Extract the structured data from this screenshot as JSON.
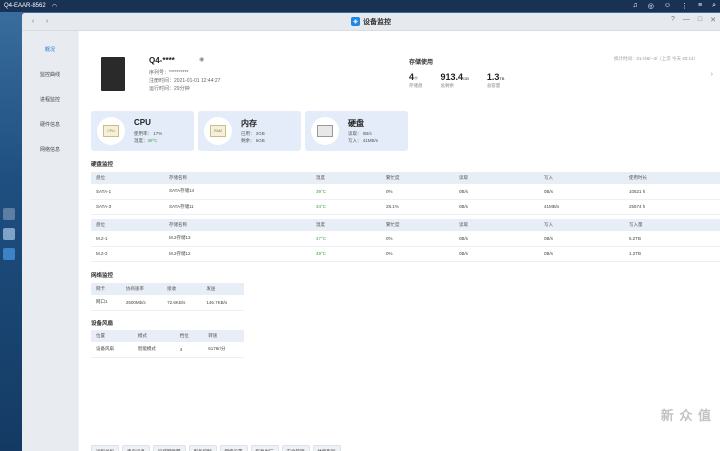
{
  "os": {
    "host": "Q4-EAAR-8562",
    "wifi_icon": "wifi-icon"
  },
  "window": {
    "title": "设备监控"
  },
  "sidebar": {
    "items": [
      {
        "label": "概况",
        "active": true
      },
      {
        "label": "监控曲线"
      },
      {
        "label": "进程监控"
      },
      {
        "label": "硬件信息"
      },
      {
        "label": "网络信息"
      }
    ]
  },
  "device": {
    "name": "Q4-****",
    "serial_label": "序列号：",
    "serial": "**********",
    "reg_label": "注册时间：",
    "reg": "2021-01-01 12:44:27",
    "run_label": "运行时间：",
    "run": "29分钟"
  },
  "storage": {
    "heading": "存储使用",
    "disks": "4",
    "disks_unit": "个",
    "disks_label": "存储盘",
    "cap": "913.4",
    "cap_unit": "GB",
    "cap_label": "总剩余",
    "total": "1.3",
    "total_unit": "TB",
    "total_label": "总容量",
    "uptime_note": "统计时间：01-/48/--3/（上次 今天 20:14）"
  },
  "cards": {
    "cpu": {
      "title": "CPU",
      "usage": "使用率： 17%",
      "temp_label": "温度：",
      "temp": "39°C",
      "icon": "CPU"
    },
    "mem": {
      "title": "内存",
      "used": "已用： 2GB",
      "free": "剩余： 6GB",
      "icon": "RAM"
    },
    "disk": {
      "title": "硬盘",
      "read": "读取： 0B/s",
      "write": "写入： 41MB/s"
    }
  },
  "disk_monitor": {
    "title": "硬盘监控",
    "sata_headers": [
      "盘位",
      "存储名称",
      "温度",
      "繁忙度",
      "读取",
      "写入",
      "使用时长"
    ],
    "sata_rows": [
      [
        "SATA-1",
        "SATA存储14",
        "39°C",
        "0%",
        "0B/s",
        "0B/s",
        "10521 h"
      ],
      [
        "SATA-3",
        "SATA存储11",
        "34°C",
        "28.1%",
        "0B/s",
        "41MB/s",
        "25574 h"
      ]
    ],
    "m2_headers": [
      "盘位",
      "存储名称",
      "温度",
      "繁忙度",
      "读取",
      "写入",
      "写入量"
    ],
    "m2_rows": [
      [
        "M.2-1",
        "M.2存储13",
        "47°C",
        "0%",
        "0B/s",
        "0B/s",
        "5.2TB"
      ],
      [
        "M.2-2",
        "M.2存储12",
        "49°C",
        "0%",
        "0B/s",
        "0B/s",
        "1.2TB"
      ]
    ]
  },
  "network": {
    "title": "网络监控",
    "headers": [
      "网卡",
      "协商速率",
      "接收",
      "发送"
    ],
    "rows": [
      [
        "网口1",
        "2500Mb/s",
        "72.6KB/s",
        "146.7KB/s"
      ]
    ]
  },
  "fans": {
    "title": "设备风扇",
    "headers": [
      "位置",
      "模式",
      "档位",
      "转速"
    ],
    "rows": [
      [
        "设备风扇",
        "智能模式",
        "4",
        "6178r/分"
      ]
    ]
  },
  "actions": [
    "远程关机",
    "重启设备",
    "局域网唤醒",
    "服务控制",
    "网络设置",
    "恢复出厂",
    "安全管理",
    "休眠告别"
  ],
  "watermark": "新 众 值",
  "colors": {
    "accent": "#1e88e5",
    "temp_green": "#43a047"
  }
}
